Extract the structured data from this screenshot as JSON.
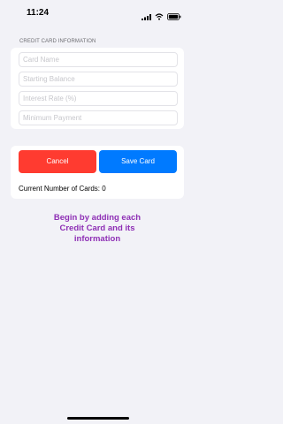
{
  "status_bar": {
    "time": "11:24",
    "icons": [
      "signal-icon",
      "wifi-icon",
      "battery-icon"
    ]
  },
  "form": {
    "section_header": "CREDIT CARD INFORMATION",
    "fields": [
      {
        "placeholder": "Card Name",
        "value": ""
      },
      {
        "placeholder": "Starting Balance",
        "value": ""
      },
      {
        "placeholder": "Interest Rate (%)",
        "value": ""
      },
      {
        "placeholder": "Minimum Payment",
        "value": ""
      }
    ]
  },
  "actions": {
    "cancel_label": "Cancel",
    "save_label": "Save Card",
    "card_count_text": "Current Number of Cards: 0"
  },
  "message": "Begin by adding each Credit Card and its information",
  "colors": {
    "background": "#f2f2f7",
    "cancel": "#ff3b30",
    "save": "#007aff",
    "message": "#8e2fb5",
    "placeholder": "#c7c7cc"
  }
}
